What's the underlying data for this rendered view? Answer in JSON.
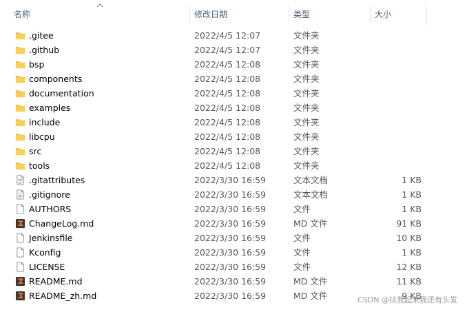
{
  "header": {
    "name": "名称",
    "date": "修改日期",
    "type": "类型",
    "size": "大小"
  },
  "files": [
    {
      "name": ".gitee",
      "date": "2022/4/5 12:07",
      "type": "文件夹",
      "size": "",
      "icon": "folder-icon"
    },
    {
      "name": ".github",
      "date": "2022/4/5 12:07",
      "type": "文件夹",
      "size": "",
      "icon": "folder-icon"
    },
    {
      "name": "bsp",
      "date": "2022/4/5 12:08",
      "type": "文件夹",
      "size": "",
      "icon": "folder-icon"
    },
    {
      "name": "components",
      "date": "2022/4/5 12:08",
      "type": "文件夹",
      "size": "",
      "icon": "folder-icon"
    },
    {
      "name": "documentation",
      "date": "2022/4/5 12:08",
      "type": "文件夹",
      "size": "",
      "icon": "folder-icon"
    },
    {
      "name": "examples",
      "date": "2022/4/5 12:08",
      "type": "文件夹",
      "size": "",
      "icon": "folder-icon"
    },
    {
      "name": "include",
      "date": "2022/4/5 12:08",
      "type": "文件夹",
      "size": "",
      "icon": "folder-icon"
    },
    {
      "name": "libcpu",
      "date": "2022/4/5 12:08",
      "type": "文件夹",
      "size": "",
      "icon": "folder-icon"
    },
    {
      "name": "src",
      "date": "2022/4/5 12:08",
      "type": "文件夹",
      "size": "",
      "icon": "folder-icon"
    },
    {
      "name": "tools",
      "date": "2022/4/5 12:08",
      "type": "文件夹",
      "size": "",
      "icon": "folder-icon"
    },
    {
      "name": ".gitattributes",
      "date": "2022/3/30 16:59",
      "type": "文本文档",
      "size": "1 KB",
      "icon": "text-document-icon"
    },
    {
      "name": ".gitignore",
      "date": "2022/3/30 16:59",
      "type": "文本文档",
      "size": "1 KB",
      "icon": "text-document-icon"
    },
    {
      "name": "AUTHORS",
      "date": "2022/3/30 16:59",
      "type": "文件",
      "size": "1 KB",
      "icon": "file-icon"
    },
    {
      "name": "ChangeLog.md",
      "date": "2022/3/30 16:59",
      "type": "MD 文件",
      "size": "91 KB",
      "icon": "markdown-file-icon"
    },
    {
      "name": "Jenkinsfile",
      "date": "2022/3/30 16:59",
      "type": "文件",
      "size": "10 KB",
      "icon": "file-icon"
    },
    {
      "name": "Kconfig",
      "date": "2022/3/30 16:59",
      "type": "文件",
      "size": "1 KB",
      "icon": "file-icon"
    },
    {
      "name": "LICENSE",
      "date": "2022/3/30 16:59",
      "type": "文件",
      "size": "12 KB",
      "icon": "file-icon"
    },
    {
      "name": "README.md",
      "date": "2022/3/30 16:59",
      "type": "MD 文件",
      "size": "11 KB",
      "icon": "markdown-file-icon"
    },
    {
      "name": "README_zh.md",
      "date": "2022/3/30 16:59",
      "type": "MD 文件",
      "size": "9 KB",
      "icon": "markdown-file-icon"
    }
  ],
  "colors": {
    "folder": "#f8cf5b",
    "folder_dark": "#e8b53a",
    "markdown_bg": "#e9762b",
    "header_text": "#4c607a"
  },
  "watermark": "CSDN @扶我起来我还有头发"
}
